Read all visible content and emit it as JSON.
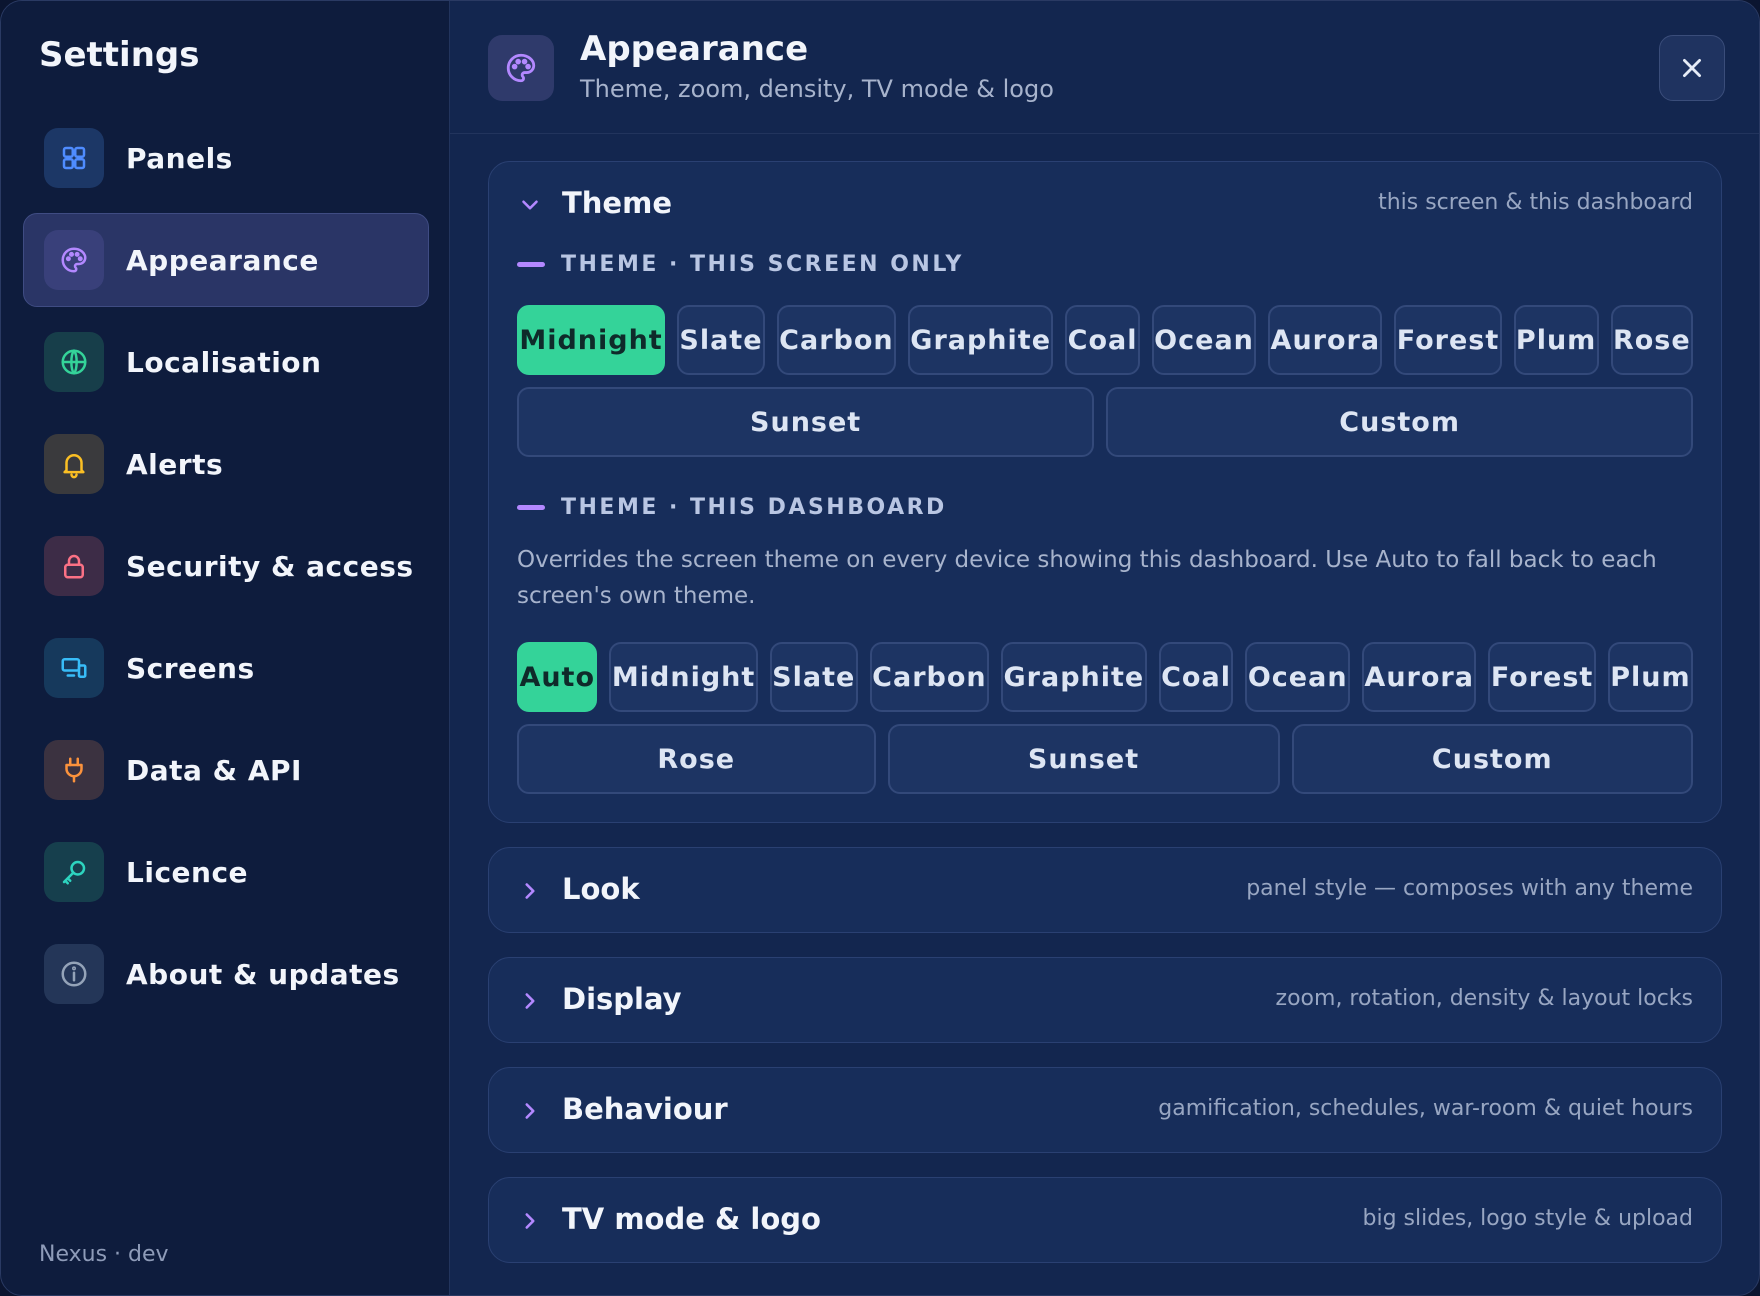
{
  "sidebar": {
    "title": "Settings",
    "items": [
      {
        "label": "Panels",
        "icon": "grid-icon",
        "color": "#4f8cff",
        "bg": "#1c3766"
      },
      {
        "label": "Appearance",
        "icon": "palette-icon",
        "color": "#b388ff",
        "bg": "#39407a",
        "active": true
      },
      {
        "label": "Localisation",
        "icon": "globe-icon",
        "color": "#34d399",
        "bg": "#173e4a"
      },
      {
        "label": "Alerts",
        "icon": "bell-icon",
        "color": "#fbbf24",
        "bg": "#3a3a3d"
      },
      {
        "label": "Security & access",
        "icon": "lock-icon",
        "color": "#fb7185",
        "bg": "#3d2c47"
      },
      {
        "label": "Screens",
        "icon": "devices-icon",
        "color": "#38bdf8",
        "bg": "#16395c"
      },
      {
        "label": "Data & API",
        "icon": "plug-icon",
        "color": "#fb923c",
        "bg": "#3b3240"
      },
      {
        "label": "Licence",
        "icon": "key-icon",
        "color": "#2dd4bf",
        "bg": "#163f4d"
      },
      {
        "label": "About & updates",
        "icon": "info-icon",
        "color": "#94a3b8",
        "bg": "#243658"
      }
    ],
    "footer": "Nexus · dev"
  },
  "header": {
    "title": "Appearance",
    "subtitle": "Theme, zoom, density, TV mode & logo",
    "icon": "palette-icon",
    "close_icon": "close-icon"
  },
  "theme_card": {
    "title": "Theme",
    "hint": "this screen & this dashboard",
    "screen_section": {
      "label": "THEME · THIS SCREEN ONLY",
      "options": [
        "Midnight",
        "Slate",
        "Carbon",
        "Graphite",
        "Coal",
        "Ocean",
        "Aurora",
        "Forest",
        "Plum",
        "Rose",
        "Sunset",
        "Custom"
      ],
      "selected": "Midnight"
    },
    "dashboard_section": {
      "label": "THEME · THIS DASHBOARD",
      "description": "Overrides the screen theme on every device showing this dashboard. Use Auto to fall back to each screen's own theme.",
      "options": [
        "Auto",
        "Midnight",
        "Slate",
        "Carbon",
        "Graphite",
        "Coal",
        "Ocean",
        "Aurora",
        "Forest",
        "Plum",
        "Rose",
        "Sunset",
        "Custom"
      ],
      "selected": "Auto"
    }
  },
  "collapsed_sections": [
    {
      "title": "Look",
      "hint": "panel style — composes with any theme"
    },
    {
      "title": "Display",
      "hint": "zoom, rotation, density & layout locks"
    },
    {
      "title": "Behaviour",
      "hint": "gamification, schedules, war-room & quiet hours"
    },
    {
      "title": "TV mode & logo",
      "hint": "big slides, logo style & upload"
    }
  ],
  "colors": {
    "accent": "#b388ff",
    "selected": "#34d399"
  }
}
